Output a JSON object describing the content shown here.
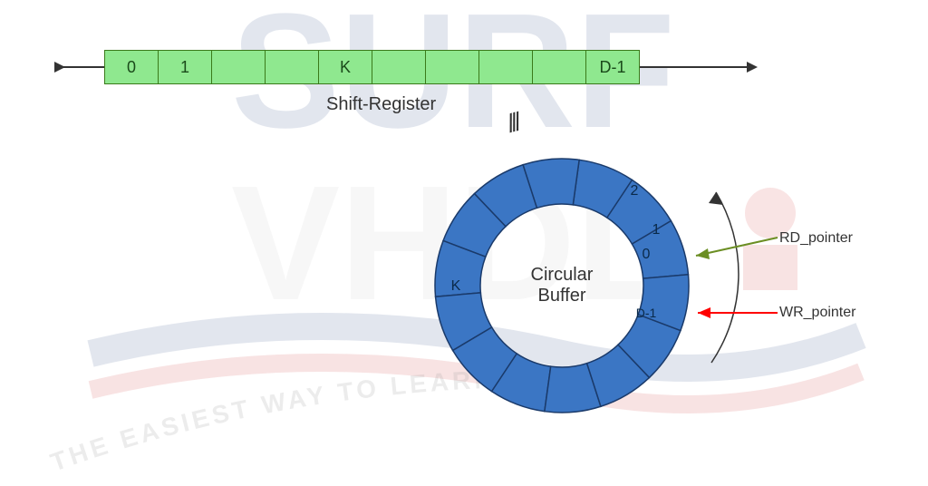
{
  "shift_register": {
    "label": "Shift-Register",
    "cells": [
      "0",
      "1",
      "",
      "",
      "K",
      "",
      "",
      "",
      "",
      "D-1"
    ]
  },
  "circular_buffer": {
    "label_line1": "Circular",
    "label_line2": "Buffer",
    "segments": 14,
    "segment_labels": {
      "seg_0": "0",
      "seg_1": "1",
      "seg_2": "2",
      "seg_k": "K",
      "seg_dminus1": "D-1"
    }
  },
  "pointers": {
    "rd": "RD_pointer",
    "wr": "WR_pointer"
  },
  "equiv_marks": "///",
  "colors": {
    "reg_fill": "#8fe88f",
    "reg_border": "#3a7a1a",
    "circle_fill": "#3b76c4",
    "circle_border": "#1a3a6a",
    "rd_arrow": "#6b8e23",
    "wr_arrow": "#ff0000"
  },
  "watermark": {
    "text_top": "SURF",
    "text_mid": "VHDL",
    "tagline": "THE EASIEST WAY TO LEARN VHDL"
  }
}
